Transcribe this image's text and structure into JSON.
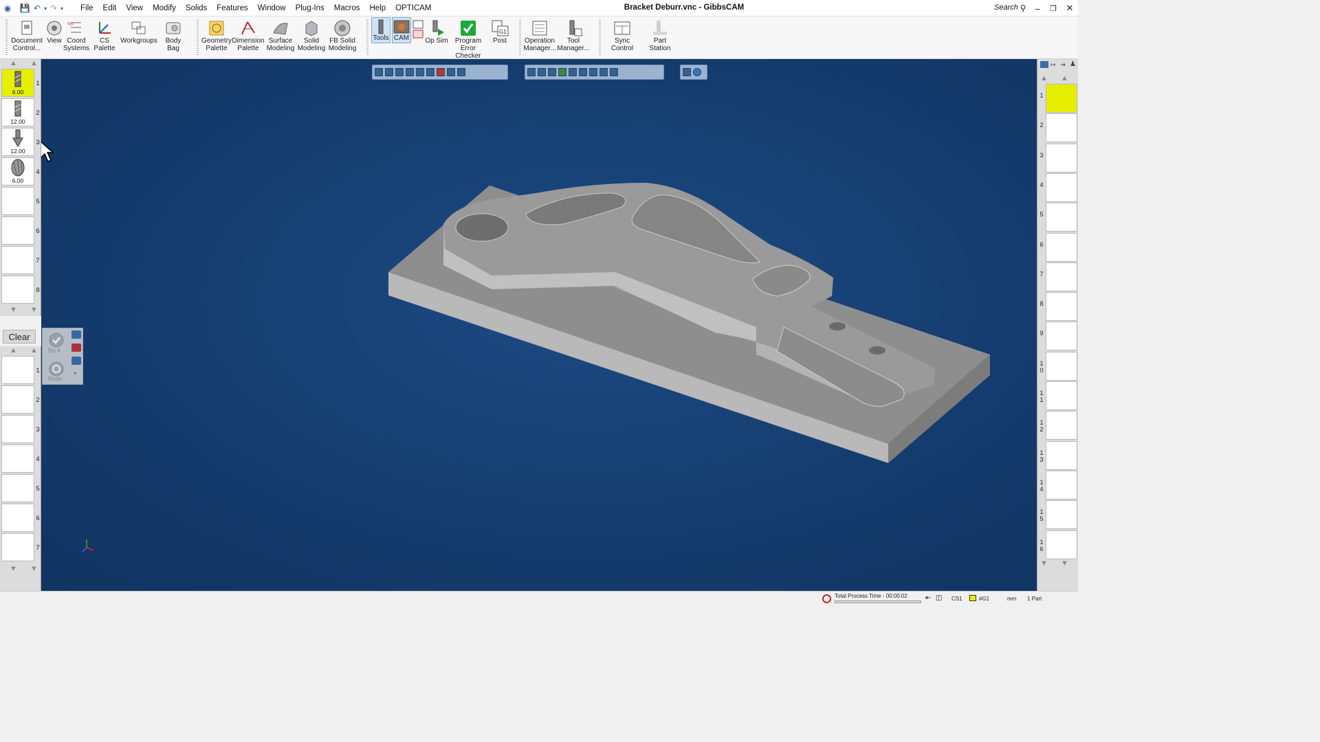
{
  "window": {
    "title": "Bracket Deburr.vnc - GibbsCAM",
    "search_label": "Search"
  },
  "menu": [
    "File",
    "Edit",
    "View",
    "Modify",
    "Solids",
    "Features",
    "Window",
    "Plug-Ins",
    "Macros",
    "Help",
    "OPTICAM"
  ],
  "ribbon": {
    "document_control": "Document\nControl...",
    "view": "View",
    "coord_systems": "Coord\nSystems",
    "cs_palette": "CS Palette",
    "workgroups": "Workgroups",
    "body_bag": "Body Bag",
    "geometry_palette": "Geometry\nPalette",
    "dimension_palette": "Dimension\nPalette",
    "surface_modeling": "Surface\nModeling",
    "solid_modeling": "Solid\nModeling",
    "fb_solid_modeling": "FB Solid\nModeling",
    "tools": "Tools",
    "cam": "CAM",
    "op_sim": "Op Sim",
    "program_error_checker": "Program\nError Checker",
    "post": "Post",
    "operation_manager": "Operation\nManager...",
    "tool_manager": "Tool\nManager...",
    "sync_control": "Sync Control",
    "part_station": "Part Station",
    "post_badge": "G1"
  },
  "tool_list": {
    "slots": [
      {
        "num": "1",
        "value": "6.00",
        "active": true
      },
      {
        "num": "2",
        "value": "12.00",
        "active": false
      },
      {
        "num": "3",
        "value": "12.00",
        "active": false
      },
      {
        "num": "4",
        "value": "6.00",
        "active": false
      },
      {
        "num": "5",
        "value": "",
        "active": false
      },
      {
        "num": "6",
        "value": "",
        "active": false
      },
      {
        "num": "7",
        "value": "",
        "active": false
      },
      {
        "num": "8",
        "value": "",
        "active": false
      }
    ]
  },
  "process_list": {
    "clear_label": "Clear",
    "do_it_label": "Do It",
    "redo_label": "Redo",
    "slots": [
      "1",
      "2",
      "3",
      "4",
      "5",
      "6",
      "7"
    ]
  },
  "op_list": {
    "slots": [
      "1",
      "2",
      "3",
      "4",
      "5",
      "6",
      "7",
      "8",
      "9",
      "1\n0",
      "1\n1",
      "1\n2",
      "1\n3",
      "1\n4",
      "1\n5",
      "1\n6"
    ]
  },
  "status": {
    "process_time": "Total Process Time - 00:00:02",
    "cs": "CS1",
    "g1": "#G1",
    "units": "mm",
    "parts": "1 Part"
  },
  "colors": {
    "viewport_bg": "#153c6e",
    "active_slot": "#e6ef00",
    "part_face": "#b9b9b9"
  }
}
